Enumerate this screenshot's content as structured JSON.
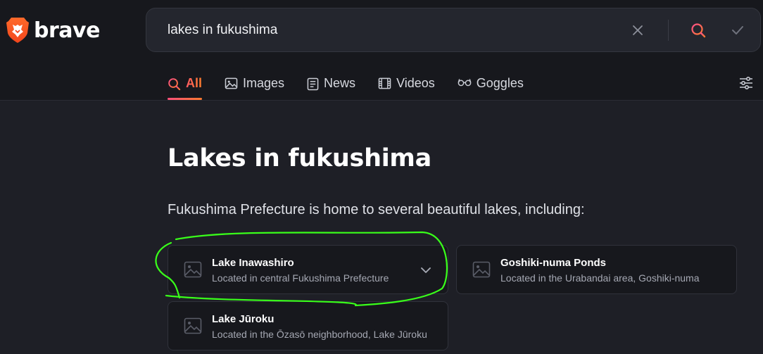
{
  "brand": {
    "name": "brave",
    "accent": "#ff5a2a"
  },
  "search": {
    "query": "lakes in fukushima"
  },
  "tabs": [
    {
      "label": "All",
      "icon": "search-icon",
      "active": true
    },
    {
      "label": "Images",
      "icon": "image-icon"
    },
    {
      "label": "News",
      "icon": "newspaper-icon"
    },
    {
      "label": "Videos",
      "icon": "film-icon"
    },
    {
      "label": "Goggles",
      "icon": "goggles-icon"
    }
  ],
  "answer": {
    "heading": "Lakes in fukushima",
    "intro": "Fukushima Prefecture is home to several beautiful lakes, including:",
    "cards": [
      {
        "title": "Lake Inawashiro",
        "desc": "Located in central Fukushima Prefecture"
      },
      {
        "title": "Goshiki-numa Ponds",
        "desc": "Located in the Urabandai area, Goshiki-numa"
      },
      {
        "title": "Lake Jūroku",
        "desc": "Located in the Ōzasō neighborhood, Lake Jūroku"
      }
    ]
  },
  "annotation": {
    "color": "#39ff1a"
  }
}
